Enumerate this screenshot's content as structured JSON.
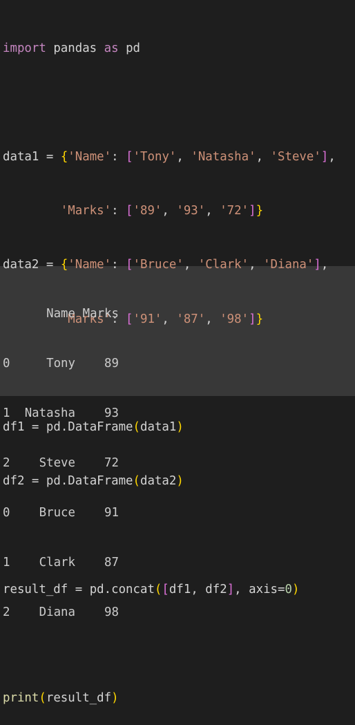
{
  "editor": {
    "code_lines": [
      "import pandas as pd",
      "",
      "data1 = {'Name': ['Tony', 'Natasha', 'Steve'],",
      "        'Marks': ['89', '93', '72']}",
      "data2 = {'Name': ['Bruce', 'Clark', 'Diana'],",
      "        'Marks': ['91', '87', '98']}",
      "",
      "df1 = pd.DataFrame(data1)",
      "df2 = pd.DataFrame(data2)",
      "",
      "result_df = pd.concat([df1, df2], axis=0)",
      "",
      "print(result_df)"
    ],
    "tokens": {
      "import": "import",
      "pandas": "pandas",
      "as": "as",
      "pd": "pd",
      "data1": "data1",
      "data2": "data2",
      "eq": "=",
      "name_key": "'Name'",
      "marks_key": "'Marks'",
      "d1_names": [
        "'Tony'",
        "'Natasha'",
        "'Steve'"
      ],
      "d1_marks": [
        "'89'",
        "'93'",
        "'72'"
      ],
      "d2_names": [
        "'Bruce'",
        "'Clark'",
        "'Diana'"
      ],
      "d2_marks": [
        "'91'",
        "'87'",
        "'98'"
      ],
      "df1": "df1",
      "df2": "df2",
      "pd_dataframe": "pd.DataFrame",
      "result_df": "result_df",
      "pd_concat": "pd.concat",
      "axis": "axis",
      "zero": "0",
      "print": "print"
    }
  },
  "output": {
    "columns": [
      "",
      "Name",
      "Marks"
    ],
    "rows": [
      {
        "index": "0",
        "name": "Tony",
        "marks": "89"
      },
      {
        "index": "1",
        "name": "Natasha",
        "marks": "93"
      },
      {
        "index": "2",
        "name": "Steve",
        "marks": "72"
      },
      {
        "index": "0",
        "name": "Bruce",
        "marks": "91"
      },
      {
        "index": "1",
        "name": "Clark",
        "marks": "87"
      },
      {
        "index": "2",
        "name": "Diana",
        "marks": "98"
      }
    ]
  }
}
